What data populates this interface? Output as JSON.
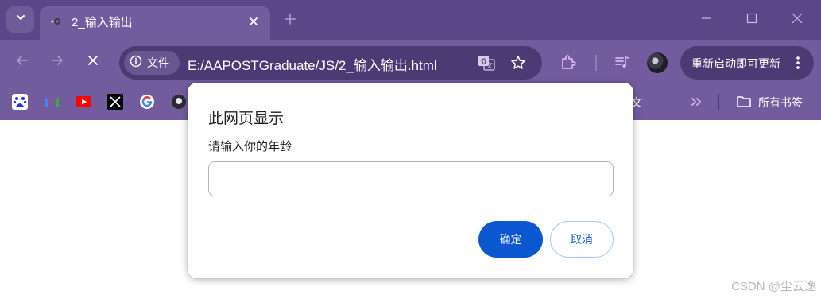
{
  "colors": {
    "tab_strip": "#5b4787",
    "toolbar": "#725c9e",
    "omnibox": "#4c3a74",
    "primary_button": "#0b57d0"
  },
  "tab": {
    "title": "2_输入输出",
    "favicon": "page-loading-icon"
  },
  "toolbar": {
    "site_chip_label": "文件",
    "url": "E:/AAPOSTGraduate/JS/2_输入输出.html",
    "restart_label": "重新启动即可更新"
  },
  "bookmarks": {
    "items": [
      "baidu-icon",
      "gmail-icon",
      "youtube-icon",
      "x-icon",
      "google-icon",
      "github-icon"
    ],
    "partial_label": "论文",
    "all_bookmarks_label": "所有书签"
  },
  "dialog": {
    "title": "此网页显示",
    "message": "请输入你的年龄",
    "input_value": "",
    "ok_label": "确定",
    "cancel_label": "取消"
  },
  "watermark": "CSDN @尘云逸"
}
